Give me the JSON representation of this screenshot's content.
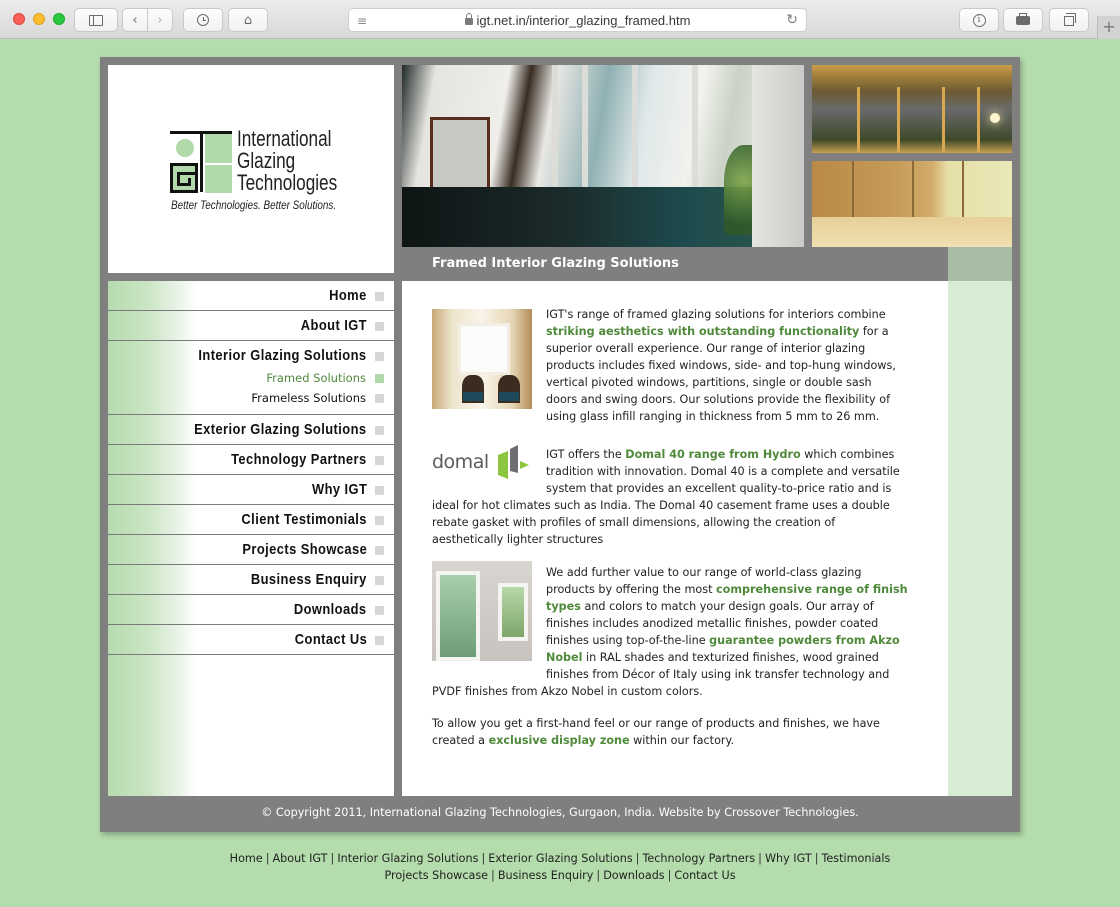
{
  "browser": {
    "url": "igt.net.in/interior_glazing_framed.htm",
    "icons": [
      "sidebar-icon",
      "back-icon",
      "forward-icon",
      "history-icon",
      "home-icon",
      "reader-icon",
      "lock-icon",
      "reload-icon",
      "info-icon",
      "print-icon",
      "tabs-icon",
      "new-tab-icon"
    ],
    "new_tab_label": "+"
  },
  "logo": {
    "line1": "International",
    "line2": "Glazing",
    "line3": "Technologies",
    "tagline": "Better Technologies. Better Solutions.",
    "accent_color": "#b2d9a9"
  },
  "page_title": "Framed Interior Glazing Solutions",
  "sidebar": {
    "items": [
      {
        "label": "Home"
      },
      {
        "label": "About IGT"
      },
      {
        "label": "Interior Glazing Solutions",
        "subitems": [
          {
            "label": "Framed Solutions",
            "active": true
          },
          {
            "label": "Frameless Solutions",
            "active": false
          }
        ]
      },
      {
        "label": "Exterior Glazing Solutions"
      },
      {
        "label": "Technology Partners"
      },
      {
        "label": "Why IGT"
      },
      {
        "label": "Client Testimonials"
      },
      {
        "label": "Projects Showcase"
      },
      {
        "label": "Business Enquiry"
      },
      {
        "label": "Downloads"
      },
      {
        "label": "Contact Us"
      }
    ]
  },
  "content": {
    "p1": {
      "before": "IGT's range of framed glazing solutions for interiors combine ",
      "highlight": "striking aesthetics with outstanding functionality",
      "after": " for a superior overall experience. Our range of interior glazing products includes fixed windows, side- and top-hung windows, vertical pivoted windows, partitions, single or double sash doors and swing doors. Our solutions provide the flexibility of using glass infill ranging in thickness from 5 mm to 26 mm."
    },
    "domal_logo_text": "domal",
    "p2": {
      "before": "IGT offers the ",
      "highlight": "Domal 40 range from Hydro",
      "after": " which combines tradition with innovation. Domal 40 is a complete and versatile system that provides an excellent quality-to-price ratio and is ideal for hot climates such as India. The Domal 40 casement frame uses a double rebate gasket with profiles of small dimensions, allowing the creation of aesthetically lighter structures"
    },
    "p3": {
      "before": "We add further value to our range of world-class glazing products by offering the most ",
      "highlight1": "comprehensive range of finish types",
      "middle": " and colors to match your design goals. Our array of finishes includes anodized metallic finishes, powder coated finishes using top-of-the-line ",
      "highlight2": "guarantee powders from Akzo Nobel",
      "after": " in RAL shades and texturized finishes, wood grained finishes from Décor of Italy using ink transfer technology and PVDF finishes from Akzo Nobel in custom colors."
    },
    "p4": {
      "before": "To allow you get a first-hand feel or our range of products and finishes, we have created a ",
      "highlight": "exclusive display zone",
      "after": " within our factory."
    }
  },
  "footer": {
    "copyright": "© Copyright 2011, International Glazing Technologies, Gurgaon, India. Website by Crossover Technologies.",
    "links_row1": [
      "Home",
      "About IGT",
      "Interior Glazing Solutions",
      "Exterior Glazing Solutions",
      "Technology Partners",
      "Why IGT",
      "Testimonials"
    ],
    "links_row2": [
      "Projects Showcase",
      "Business Enquiry",
      "Downloads",
      "Contact Us"
    ],
    "separator": "|"
  },
  "colors": {
    "page_bg": "#b4dcac",
    "frame_gray": "#7f7f7f",
    "highlight_green": "#4f8a3b",
    "strip_green": "#d8ebd4"
  }
}
